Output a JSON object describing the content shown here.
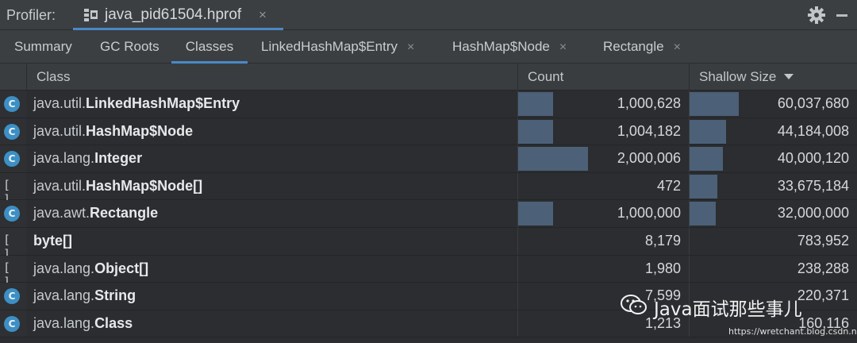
{
  "titlebar": {
    "label": "Profiler:",
    "file_tab": "java_pid61504.hprof",
    "close_glyph": "×",
    "icons": [
      "hprof-file-icon",
      "close-icon",
      "gear-icon",
      "minimize-icon"
    ]
  },
  "tabs": [
    {
      "label": "Summary",
      "closable": false,
      "active": false
    },
    {
      "label": "GC Roots",
      "closable": false,
      "active": false
    },
    {
      "label": "Classes",
      "closable": false,
      "active": true
    },
    {
      "label": "LinkedHashMap$Entry",
      "closable": true,
      "active": false
    },
    {
      "label": "HashMap$Node",
      "closable": true,
      "active": false
    },
    {
      "label": "Rectangle",
      "closable": true,
      "active": false
    }
  ],
  "table": {
    "headers": {
      "class": "Class",
      "count": "Count",
      "shallow": "Shallow Size"
    },
    "sort": {
      "column": "Shallow Size",
      "direction": "descending"
    },
    "rows": [
      {
        "icon": "class",
        "pkg": "java.util.",
        "name": "LinkedHashMap$Entry",
        "count": "1,000,628",
        "size": "60,037,680",
        "count_share": 0.5,
        "size_share": 1.0
      },
      {
        "icon": "class",
        "pkg": "java.util.",
        "name": "HashMap$Node",
        "count": "1,004,182",
        "size": "44,184,008",
        "count_share": 0.5,
        "size_share": 0.74
      },
      {
        "icon": "class",
        "pkg": "java.lang.",
        "name": "Integer",
        "count": "2,000,006",
        "size": "40,000,120",
        "count_share": 1.0,
        "size_share": 0.67
      },
      {
        "icon": "array",
        "pkg": "java.util.",
        "name": "HashMap$Node[]",
        "count": "472",
        "size": "33,675,184",
        "count_share": 0.0,
        "size_share": 0.56
      },
      {
        "icon": "class",
        "pkg": "java.awt.",
        "name": "Rectangle",
        "count": "1,000,000",
        "size": "32,000,000",
        "count_share": 0.5,
        "size_share": 0.53
      },
      {
        "icon": "array",
        "pkg": "",
        "name": "byte[]",
        "count": "8,179",
        "size": "783,952",
        "count_share": 0.0,
        "size_share": 0.0
      },
      {
        "icon": "array",
        "pkg": "java.lang.",
        "name": "Object[]",
        "count": "1,980",
        "size": "238,288",
        "count_share": 0.0,
        "size_share": 0.0
      },
      {
        "icon": "class",
        "pkg": "java.lang.",
        "name": "String",
        "count": "7,599",
        "size": "220,371",
        "count_share": 0.0,
        "size_share": 0.0
      },
      {
        "icon": "class",
        "pkg": "java.lang.",
        "name": "Class",
        "count": "1,213",
        "size": "160,116",
        "count_share": 0.0,
        "size_share": 0.0
      }
    ],
    "icon_glyphs": {
      "class": "C",
      "array": "[ ]"
    }
  },
  "watermark": {
    "text": "Java面试那些事儿",
    "url": "https://wretchant.blog.csdn.net"
  },
  "colors": {
    "accent": "#4a88c7",
    "bar": "#4c6078",
    "class_icon": "#3d8fc4",
    "background": "#2b2d30"
  }
}
